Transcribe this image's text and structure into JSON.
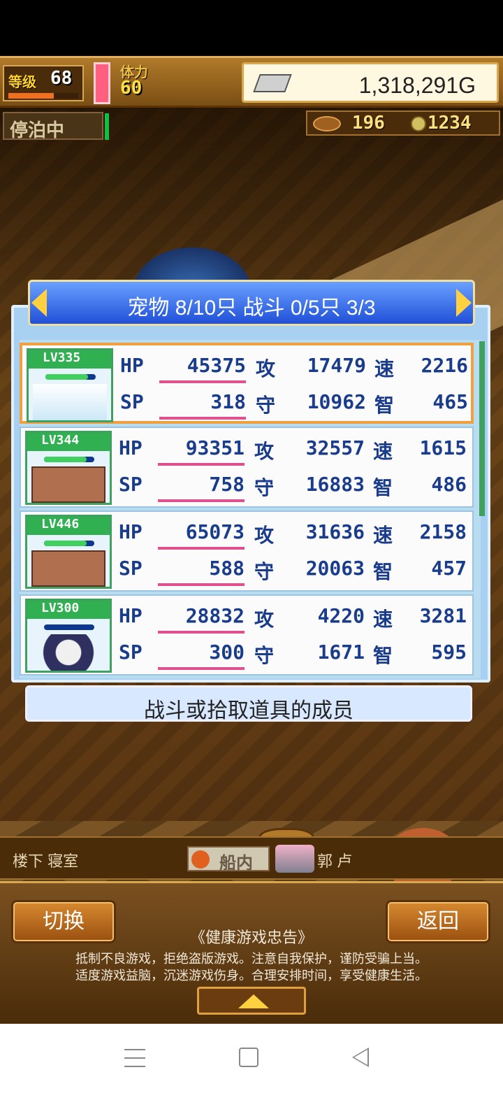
{
  "hud": {
    "level_label": "等级",
    "level_value": "68",
    "level_bar_fraction": 0.65,
    "stamina_label": "体力",
    "stamina_value": "60",
    "gold": "1,318,291G",
    "status": "停泊中",
    "resource1": "196",
    "resource2": "1234"
  },
  "dialog": {
    "title": "宠物 8/10只 战斗 0/5只  3/3",
    "caption": "战斗或拾取道具的成员",
    "labels": {
      "hp": "HP",
      "sp": "SP",
      "atk": "攻",
      "def": "守",
      "spd": "速",
      "int": "智"
    },
    "pets": [
      {
        "lv": "LV335",
        "hp": "45375",
        "sp": "318",
        "atk": "17479",
        "def": "10962",
        "spd": "2216",
        "int": "465",
        "hp_fraction": 0.85,
        "selected": true
      },
      {
        "lv": "LV344",
        "hp": "93351",
        "sp": "758",
        "atk": "32557",
        "def": "16883",
        "spd": "1615",
        "int": "486",
        "hp_fraction": 0.85,
        "selected": false
      },
      {
        "lv": "LV446",
        "hp": "65073",
        "sp": "588",
        "atk": "31636",
        "def": "20063",
        "spd": "2158",
        "int": "457",
        "hp_fraction": 0.85,
        "selected": false
      },
      {
        "lv": "LV300",
        "hp": "28832",
        "sp": "300",
        "atk": "4220",
        "def": "1671",
        "spd": "3281",
        "int": "595",
        "hp_fraction": 0.0,
        "selected": false
      }
    ]
  },
  "location": {
    "left": "楼下 寝室",
    "tag": "船内",
    "right": "郭 卢"
  },
  "bottom": {
    "switch_label": "切换",
    "back_label": "返回",
    "notice_title": "《健康游戏忠告》",
    "notice_line1": "抵制不良游戏，拒绝盗版游戏。注意自我保护，谨防受骗上当。",
    "notice_line2": "适度游戏益脑，沉迷游戏伤身。合理安排时间，享受健康生活。"
  },
  "icons": {
    "gold": "silver-bar-icon",
    "anchor": "anchor-icon",
    "res1": "fish-icon",
    "res2": "coin-icon",
    "expand": "triangle-up-icon",
    "nav_menu": "menu-icon",
    "nav_home": "home-icon",
    "nav_back": "back-icon"
  },
  "colors": {
    "accent_blue": "#2050d8",
    "selected_border": "#f0a040",
    "stat_text": "#1a3c8c",
    "hp_underline": "#e0508c"
  }
}
